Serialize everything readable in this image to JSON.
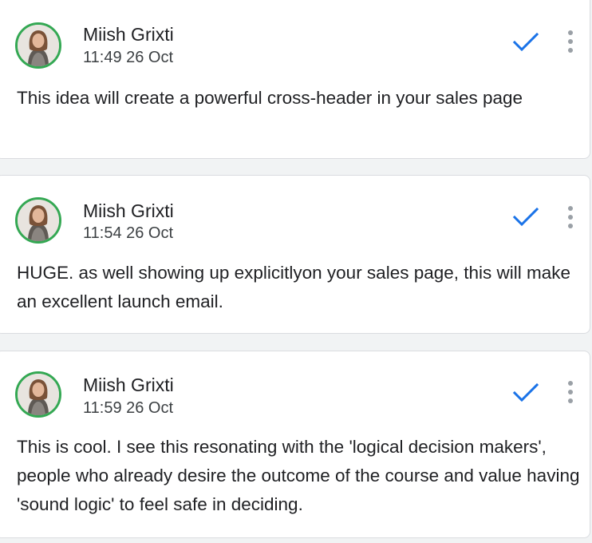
{
  "comments": [
    {
      "author": "Miish Grixti",
      "timestamp": "11:49 26 Oct",
      "text": "This idea will create a powerful cross-header in your sales page"
    },
    {
      "author": "Miish Grixti",
      "timestamp": "11:54 26 Oct",
      "text": "HUGE. as well showing up explicitlyon your sales page, this will make an excellent launch email."
    },
    {
      "author": "Miish Grixti",
      "timestamp": "11:59 26 Oct",
      "text": "This is cool. I see this resonating with the 'logical decision makers', people who already desire the outcome of the course and value having 'sound logic' to feel safe in deciding."
    }
  ],
  "colors": {
    "avatar_ring": "#34a853",
    "resolve_check": "#1a73e8",
    "more_dots": "#9aa0a6",
    "card_border": "#dadce0"
  },
  "icons": {
    "resolve": "check-icon",
    "more": "more-vert-icon"
  }
}
